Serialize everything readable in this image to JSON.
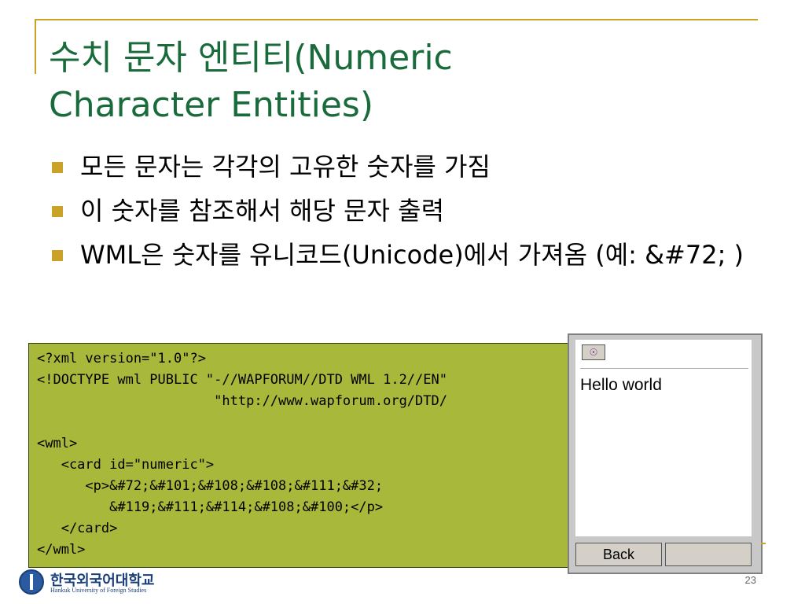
{
  "slide": {
    "title_line1": "수치 문자 엔티티(Numeric",
    "title_line2": "Character Entities)",
    "bullets": [
      "모든 문자는 각각의 고유한 숫자를 가짐",
      "이 숫자를 참조해서 해당 문자 출력",
      "WML은 숫자를 유니코드(Unicode)에서 가져옴 (예: &#72; )"
    ],
    "page_number": "23"
  },
  "code": {
    "lines": [
      "<?xml version=\"1.0\"?>",
      "<!DOCTYPE wml PUBLIC \"-//WAPFORUM//DTD WML 1.2//EN\"",
      "                      \"http://www.wapforum.org/DTD/",
      "",
      "<wml>",
      "   <card id=\"numeric\">",
      "      <p>&#72;&#101;&#108;&#108;&#111;&#32;",
      "         &#119;&#111;&#114;&#108;&#100;</p>",
      "   </card>",
      "</wml>"
    ]
  },
  "phone": {
    "screen_text": "Hello world",
    "softkey_left": "Back",
    "softkey_right": "",
    "icon": "options-icon"
  },
  "logo": {
    "name": "한국외국어대학교",
    "subtitle": "Hankuk University of Foreign Studies"
  },
  "colors": {
    "title": "#1a6b3c",
    "accent": "#c9a227",
    "code_bg": "#a8b83a"
  }
}
